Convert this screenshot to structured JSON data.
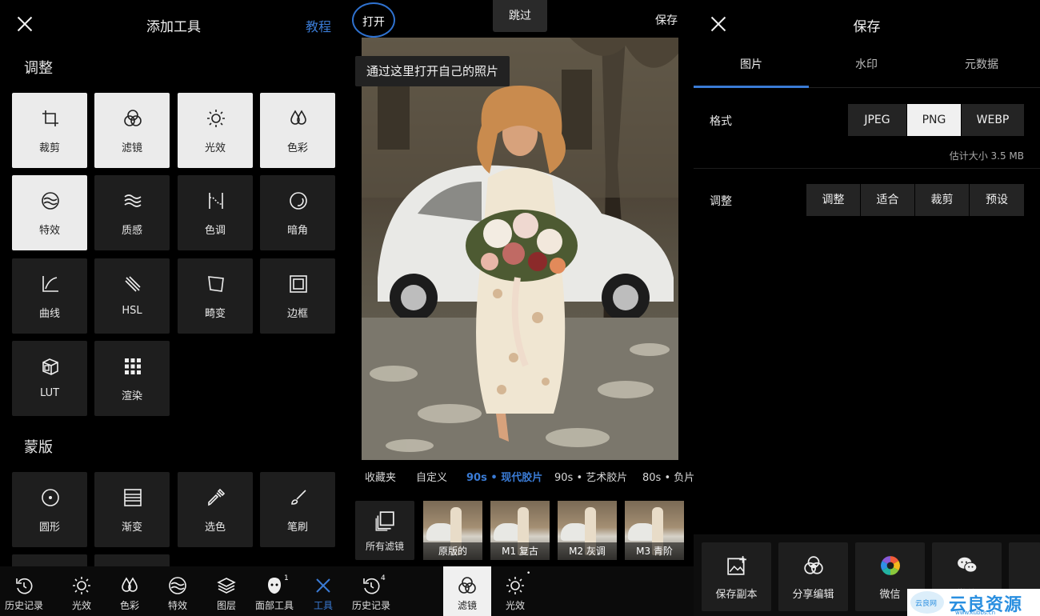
{
  "panel_add_tools": {
    "title": "添加工具",
    "tutorial_link": "教程",
    "adjust_section": "调整",
    "adjust_tools": [
      {
        "label": "裁剪",
        "icon": "crop-icon",
        "selected": true
      },
      {
        "label": "滤镜",
        "icon": "filter-icon",
        "selected": true
      },
      {
        "label": "光效",
        "icon": "sun-icon",
        "selected": true
      },
      {
        "label": "色彩",
        "icon": "drops-icon",
        "selected": true
      },
      {
        "label": "特效",
        "icon": "waves-circle-icon",
        "selected": true
      },
      {
        "label": "质感",
        "icon": "texture-waves-icon",
        "selected": false
      },
      {
        "label": "色调",
        "icon": "split-tone-icon",
        "selected": false
      },
      {
        "label": "暗角",
        "icon": "vignette-icon",
        "selected": false
      },
      {
        "label": "曲线",
        "icon": "curve-icon",
        "selected": false
      },
      {
        "label": "HSL",
        "icon": "hsl-brush-icon",
        "selected": false
      },
      {
        "label": "畸变",
        "icon": "distort-icon",
        "selected": false
      },
      {
        "label": "边框",
        "icon": "frame-icon",
        "selected": false
      },
      {
        "label": "LUT",
        "icon": "lut-cube-icon",
        "selected": false
      },
      {
        "label": "渲染",
        "icon": "grid-dots-icon",
        "selected": false
      }
    ],
    "mask_section": "蒙版",
    "mask_tools": [
      {
        "label": "圆形",
        "icon": "radial-mask-icon"
      },
      {
        "label": "渐变",
        "icon": "gradient-mask-icon"
      },
      {
        "label": "选色",
        "icon": "eyedropper-icon"
      },
      {
        "label": "笔刷",
        "icon": "brush-icon"
      }
    ],
    "bottom_nav": [
      {
        "label": "历史记录",
        "icon": "history-icon",
        "badge": ""
      },
      {
        "label": "光效",
        "icon": "sun-icon",
        "badge": ""
      },
      {
        "label": "色彩",
        "icon": "drops-icon",
        "badge": ""
      },
      {
        "label": "特效",
        "icon": "waves-circle-icon",
        "badge": ""
      },
      {
        "label": "图层",
        "icon": "layers-icon",
        "badge": ""
      },
      {
        "label": "面部工具",
        "icon": "face-icon",
        "badge": "1"
      },
      {
        "label": "工具",
        "icon": "close-icon",
        "badge": ""
      }
    ]
  },
  "panel_editor": {
    "open_label": "打开",
    "skip_label": "跳过",
    "save_label": "保存",
    "tooltip": "通过这里打开自己的照片",
    "filter_tabs": [
      "收藏夹",
      "自定义",
      "90s • 现代胶片",
      "90s • 艺术胶片",
      "80s • 负片"
    ],
    "active_filter_tab": "90s • 现代胶片",
    "all_filters_label": "所有滤镜",
    "filter_thumbs": [
      "原版的",
      "M1 复古",
      "M2 灰调",
      "M3 青阶"
    ],
    "bottom_nav": [
      {
        "label": "历史记录",
        "icon": "history-icon",
        "badge": "4"
      },
      {
        "label": "滤镜",
        "icon": "filter-icon",
        "badge": ""
      },
      {
        "label": "光效",
        "icon": "sun-icon",
        "badge": "•"
      }
    ]
  },
  "panel_save": {
    "title": "保存",
    "tabs": [
      "图片",
      "水印",
      "元数据"
    ],
    "format_label": "格式",
    "formats": [
      "JPEG",
      "PNG",
      "WEBP"
    ],
    "selected_format": "PNG",
    "estimated_size": "估计大小 3.5 MB",
    "adjust_label": "调整",
    "adjust_options": [
      "调整",
      "适合",
      "裁剪",
      "预设"
    ],
    "share_targets": [
      {
        "label": "保存副本",
        "icon": "save-copy-icon"
      },
      {
        "label": "分享编辑",
        "icon": "share-edit-icon"
      },
      {
        "label": "微信",
        "icon": "wechat-moments-icon"
      },
      {
        "label": "微信",
        "icon": "wechat-icon"
      }
    ]
  },
  "watermark": {
    "text": "云良资源网",
    "sub": "www.kubbs.cn",
    "logo_text": "云良网"
  },
  "colors": {
    "accent": "#3a7bd5",
    "tile_dark": "#1e1e1e",
    "tile_light": "#ebebeb",
    "background": "#000000"
  }
}
